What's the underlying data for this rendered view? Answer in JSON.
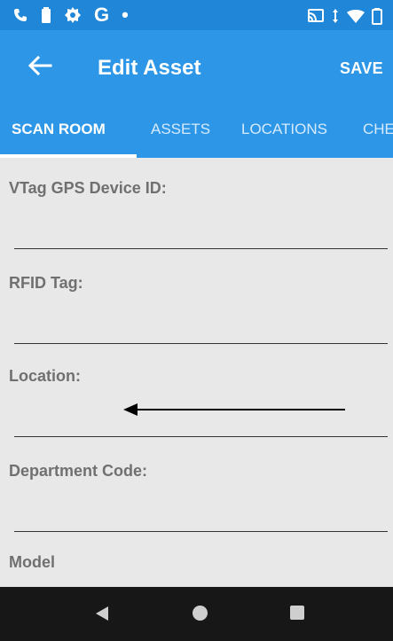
{
  "app_bar": {
    "title": "Edit Asset",
    "save_label": "SAVE"
  },
  "status_bar": {
    "g_label": "G",
    "dot_label": "•"
  },
  "tabs": [
    {
      "label": "SCAN ROOM",
      "active": true
    },
    {
      "label": "ASSETS",
      "active": false
    },
    {
      "label": "LOCATIONS",
      "active": false
    },
    {
      "label": "CHE",
      "active": false
    }
  ],
  "fields": [
    {
      "label": "VTag GPS Device ID:"
    },
    {
      "label": "RFID Tag:"
    },
    {
      "label": "Location:"
    },
    {
      "label": "Department Code:"
    },
    {
      "label": "Model"
    }
  ],
  "colors": {
    "status_bar": "#1f86d8",
    "app_bar": "#2d96e6",
    "content_background": "#e8e8e8",
    "nav_bar": "#171717"
  },
  "icons": {
    "phone": "phone-icon",
    "battery": "battery-icon",
    "settings": "gear-icon",
    "cast": "cast-icon",
    "signal": "signal-icon",
    "wifi": "wifi-icon",
    "back_arrow": "back-arrow-icon",
    "nav_back": "triangle-back-icon",
    "nav_home": "circle-home-icon",
    "nav_recent": "square-recent-icon",
    "annotation_arrow": "left-arrow-annotation"
  }
}
